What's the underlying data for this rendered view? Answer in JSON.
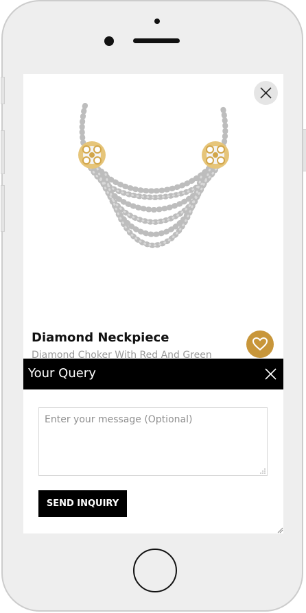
{
  "product": {
    "title": "Diamond Neckpiece",
    "subtitle": "Diamond Choker With Red And Green"
  },
  "query": {
    "title": "Your Query",
    "message_placeholder": "Enter your message (Optional)",
    "send_label": "SEND INQUIRY"
  },
  "icons": {
    "close": "close-icon",
    "favorite": "heart-icon",
    "query_close": "close-icon"
  },
  "colors": {
    "accent": "#c8963a",
    "bar": "#000000",
    "device": "#eeeeee"
  }
}
